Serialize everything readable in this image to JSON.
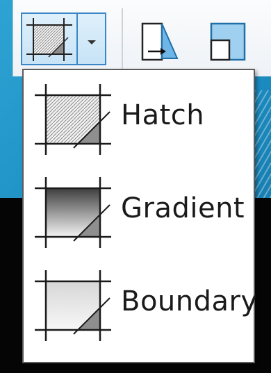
{
  "menu": {
    "items": [
      {
        "label": "Hatch",
        "icon": "hatch-icon"
      },
      {
        "label": "Gradient",
        "icon": "gradient-icon"
      },
      {
        "label": "Boundary",
        "icon": "boundary-icon"
      }
    ]
  },
  "colors": {
    "accent": "#3a86c6",
    "background": "#1d8fc4"
  }
}
